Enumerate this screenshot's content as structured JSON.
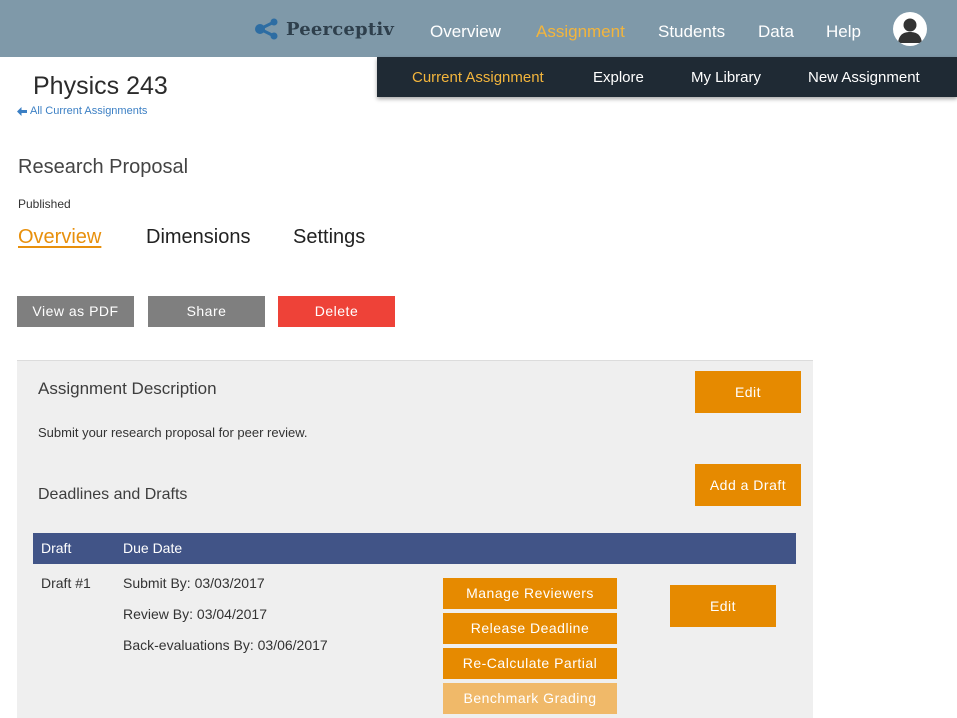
{
  "header": {
    "logo_text": "Peerceptiv",
    "nav": [
      "Overview",
      "Assignment",
      "Students",
      "Data",
      "Help"
    ],
    "active_nav": "Assignment"
  },
  "submenu": {
    "items": [
      "Current Assignment",
      "Explore",
      "My Library",
      "New Assignment"
    ],
    "active": "Current Assignment"
  },
  "page": {
    "course_title": "Physics 243",
    "back_link": "All Current Assignments",
    "assignment_title": "Research Proposal",
    "status": "Published",
    "tabs": [
      "Overview",
      "Dimensions",
      "Settings"
    ],
    "active_tab": "Overview"
  },
  "actions": {
    "view_pdf": "View as PDF",
    "share": "Share",
    "delete": "Delete"
  },
  "description": {
    "heading": "Assignment Description",
    "edit_label": "Edit",
    "text": "Submit your research proposal for peer review."
  },
  "deadlines": {
    "heading": "Deadlines and Drafts",
    "add_draft_label": "Add a Draft",
    "columns": [
      "Draft",
      "Due Date"
    ],
    "rows": [
      {
        "draft": "Draft #1",
        "submit_by": "Submit By: 03/03/2017",
        "review_by": "Review By: 03/04/2017",
        "back_eval_by": "Back-evaluations By: 03/06/2017",
        "buttons": [
          "Manage Reviewers",
          "Release Deadline",
          "Re-Calculate Partial",
          "Benchmark Grading"
        ],
        "edit_label": "Edit"
      }
    ]
  },
  "colors": {
    "topbar": "#7f99a9",
    "submenu": "#1f2a34",
    "accent": "#f3b53c",
    "orange_button": "#e68a00",
    "delete_button": "#ee4238",
    "table_header": "#415487"
  }
}
